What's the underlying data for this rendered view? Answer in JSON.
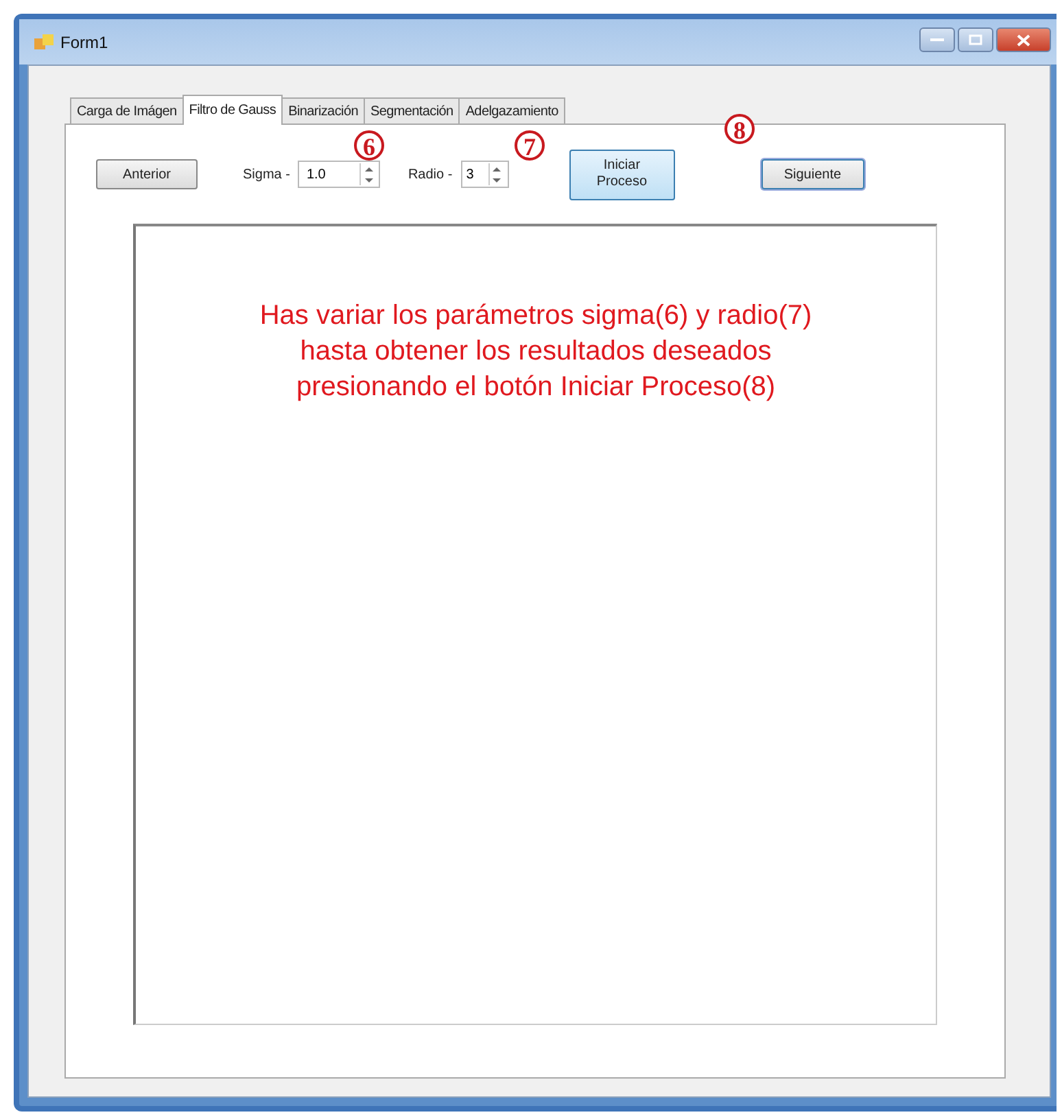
{
  "window": {
    "title": "Form1"
  },
  "tabs": [
    {
      "label": "Carga de Imágen",
      "selected": false
    },
    {
      "label": "Filtro de Gauss",
      "selected": true
    },
    {
      "label": "Binarización",
      "selected": false
    },
    {
      "label": "Segmentación",
      "selected": false
    },
    {
      "label": "Adelgazamiento",
      "selected": false
    }
  ],
  "toolbar": {
    "previous_button": "Anterior",
    "sigma_label": "Sigma -",
    "sigma_value": "1.0",
    "radius_label": "Radio -",
    "radius_value": "3",
    "start_button": "Iniciar Proceso",
    "next_button": "Siguiente"
  },
  "annotations": [
    "6",
    "7",
    "8"
  ],
  "instruction": "Has variar los parámetros sigma(6) y radio(7) hasta obtener los resultados deseados presionando el botón Iniciar Proceso(8)"
}
